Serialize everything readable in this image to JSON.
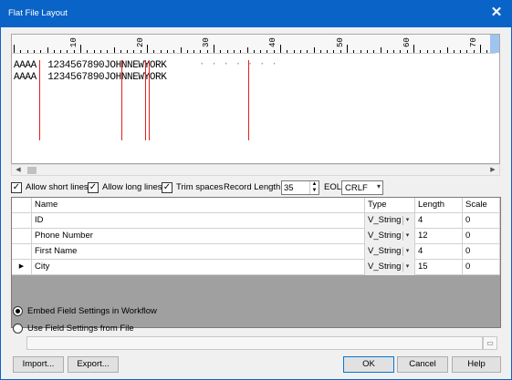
{
  "window": {
    "title": "Flat File Layout",
    "close_glyph": "✕"
  },
  "ruler": {
    "numbers": [
      "10",
      "20",
      "30",
      "40",
      "50",
      "60",
      "70"
    ]
  },
  "preview": {
    "lines": [
      "AAAA  1234567890JOHNNEWYORK",
      "AAAA  1234567890JOHNNEWYORK"
    ],
    "filler": "· · · · · · ·"
  },
  "options": {
    "allow_short_lines": "Allow short lines",
    "allow_long_lines": "Allow long lines",
    "trim_spaces": "Trim spaces",
    "record_length_label": "Record Length:",
    "record_length_value": "35",
    "eol_label": "EOL:",
    "eol_value": "CRLF"
  },
  "grid": {
    "headers": {
      "name": "Name",
      "type": "Type",
      "length": "Length",
      "scale": "Scale"
    },
    "rows": [
      {
        "name": "ID",
        "type": "V_String",
        "length": "4",
        "scale": "0"
      },
      {
        "name": "Phone Number",
        "type": "V_String",
        "length": "12",
        "scale": "0"
      },
      {
        "name": "First Name",
        "type": "V_String",
        "length": "4",
        "scale": "0"
      },
      {
        "name": "City",
        "type": "V_String",
        "length": "15",
        "scale": "0"
      }
    ]
  },
  "settings": {
    "embed_label": "Embed Field Settings in Workflow",
    "use_file_label": "Use Field Settings from File",
    "file_path": ""
  },
  "buttons": {
    "import": "Import...",
    "export": "Export...",
    "ok": "OK",
    "cancel": "Cancel",
    "help": "Help"
  }
}
